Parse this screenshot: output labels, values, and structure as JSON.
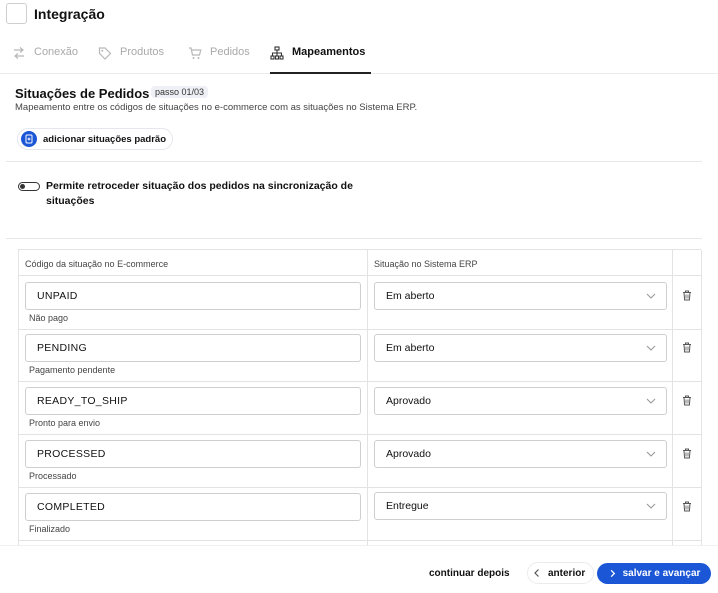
{
  "header": {
    "title": "Integração"
  },
  "tabs": [
    {
      "label": "Conexão",
      "icon": "arrows-exchange-icon",
      "active": false
    },
    {
      "label": "Produtos",
      "icon": "tag-icon",
      "active": false
    },
    {
      "label": "Pedidos",
      "icon": "cart-icon",
      "active": false
    },
    {
      "label": "Mapeamentos",
      "icon": "hierarchy-icon",
      "active": true
    }
  ],
  "section": {
    "title": "Situações de Pedidos",
    "step": "passo 01/03",
    "subtitle": "Mapeamento entre os códigos de situações no e-commerce com as situações no Sistema ERP.",
    "add_button": "adicionar situações padrão"
  },
  "toggle": {
    "label": "Permite retroceder situação dos pedidos na sincronização de situações",
    "enabled": false
  },
  "table": {
    "headers": [
      "Código da situação no E-commerce",
      "Situação no Sistema ERP"
    ],
    "rows": [
      {
        "code": "UNPAID",
        "description": "Não pago",
        "erp": "Em aberto"
      },
      {
        "code": "PENDING",
        "description": "Pagamento pendente",
        "erp": "Em aberto"
      },
      {
        "code": "READY_TO_SHIP",
        "description": "Pronto para envio",
        "erp": "Aprovado"
      },
      {
        "code": "PROCESSED",
        "description": "Processado",
        "erp": "Aprovado"
      },
      {
        "code": "COMPLETED",
        "description": "Finalizado",
        "erp": "Entregue"
      }
    ]
  },
  "footer": {
    "later": "continuar depois",
    "previous": "anterior",
    "next": "salvar e avançar"
  },
  "colors": {
    "accent": "#1a56d6",
    "tab_inactive": "#a9a9a9",
    "border": "#cfcfcf"
  }
}
